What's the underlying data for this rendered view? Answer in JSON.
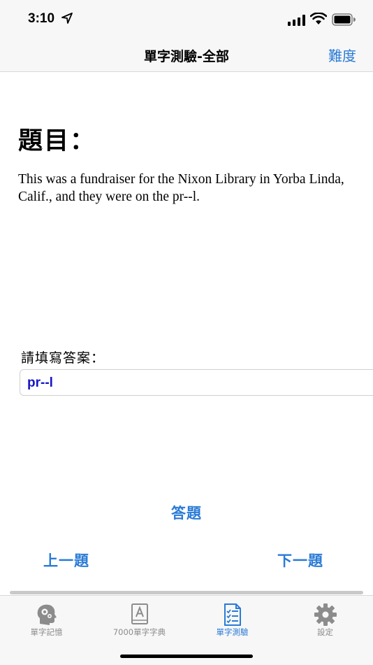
{
  "status": {
    "time": "3:10"
  },
  "nav": {
    "title": "單字測驗-全部",
    "right_button": "難度"
  },
  "question": {
    "heading": "題目：",
    "text": "This was a fundraiser for the Nixon Library in Yorba Linda, Calif., and they were on the pr--l."
  },
  "answer": {
    "label": "請填寫答案：",
    "value": "pr--l"
  },
  "buttons": {
    "answer": "答題",
    "prev": "上一題",
    "next": "下一題"
  },
  "tabs": [
    {
      "label": "單字記憶",
      "icon": "head-gears-icon",
      "active": false
    },
    {
      "label": "7000單字字典",
      "icon": "dictionary-icon",
      "active": false
    },
    {
      "label": "單字測驗",
      "icon": "checklist-icon",
      "active": true
    },
    {
      "label": "設定",
      "icon": "gear-icon",
      "active": false
    }
  ],
  "colors": {
    "accent": "#2a7bd6",
    "answer_text": "#1515c8",
    "inactive": "#8c8c8c"
  }
}
